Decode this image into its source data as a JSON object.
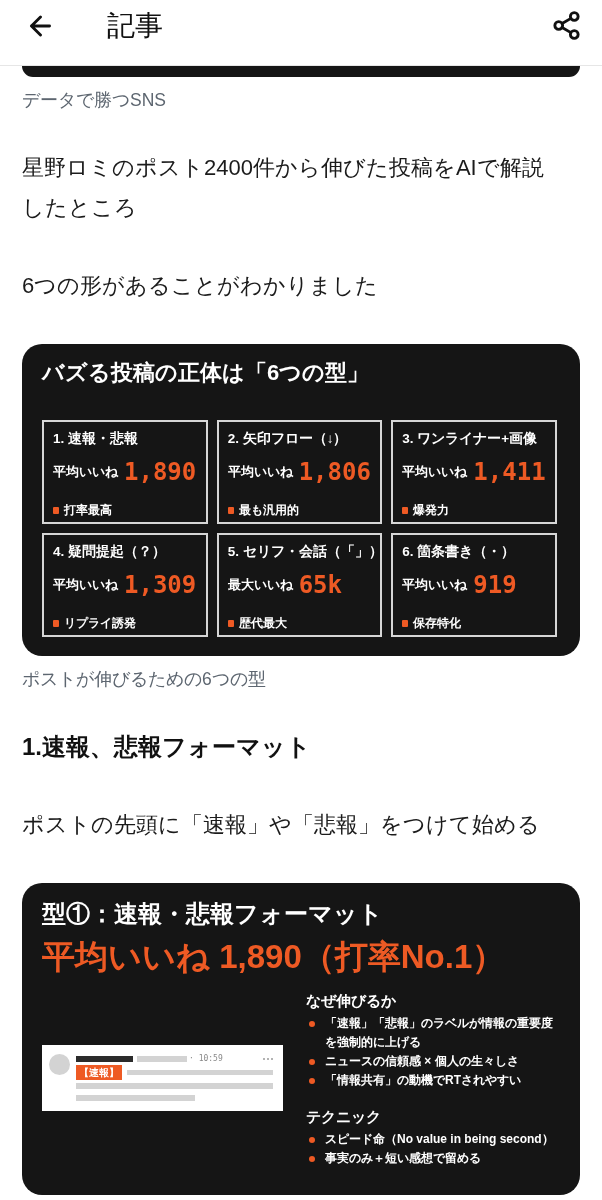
{
  "header": {
    "title": "記事"
  },
  "article": [
    {
      "kind": "caption",
      "text": "データで勝つSNS"
    },
    {
      "kind": "paragraph",
      "text": "星野ロミのポスト2400件から伸びた投稿をAIで解説したところ"
    },
    {
      "kind": "paragraph",
      "text": "6つの形があることがわかりました"
    },
    {
      "kind": "slide_grid",
      "title": "バズる投稿の正体は「6つの型」",
      "cards": [
        {
          "label": "1. 速報・悲報",
          "metric": "平均いいね",
          "value": "1,890",
          "note": "打率最高"
        },
        {
          "label": "2. 矢印フロー（↓）",
          "metric": "平均いいね",
          "value": "1,806",
          "note": "最も汎用的"
        },
        {
          "label": "3. ワンライナー+画像",
          "metric": "平均いいね",
          "value": "1,411",
          "note": "爆発力"
        },
        {
          "label": "4. 疑問提起（？）",
          "metric": "平均いいね",
          "value": "1,309",
          "note": "リプライ誘発"
        },
        {
          "label": "5. セリフ・会話（「」）",
          "metric": "最大いいね",
          "value": "65k",
          "note": "歴代最大"
        },
        {
          "label": "6. 箇条書き（・）",
          "metric": "平均いいね",
          "value": "919",
          "note": "保存特化"
        }
      ]
    },
    {
      "kind": "caption",
      "text": "ポストが伸びるための6つの型"
    },
    {
      "kind": "heading",
      "text": "1.速報、悲報フォーマット"
    },
    {
      "kind": "paragraph",
      "text": "ポストの先頭に「速報」や「悲報」をつけて始める"
    },
    {
      "kind": "slide_detail",
      "title": "型①：速報・悲報フォーマット",
      "highlight": "平均いいね 1,890（打率No.1）",
      "mock_post": {
        "time": "· 10:59",
        "tag": "【速報】"
      },
      "sections": [
        {
          "heading": "なぜ伸びるか",
          "bullets": [
            "「速報」「悲報」のラベルが情報の重要度を強制的に上げる",
            "ニュースの信頼感 × 個人の生々しさ",
            "「情報共有」の動機でRTされやすい"
          ]
        },
        {
          "heading": "テクニック",
          "bullets": [
            "スピード命（No value in being second）",
            "事実のみ＋短い感想で留める"
          ]
        }
      ]
    }
  ]
}
